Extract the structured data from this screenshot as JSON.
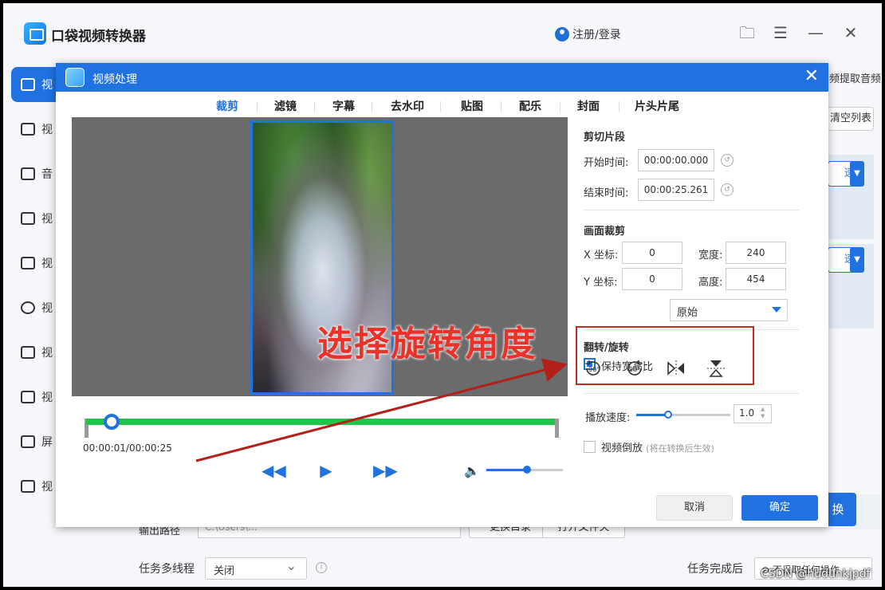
{
  "app": {
    "title": "口袋视频转换器",
    "login": "注册/登录"
  },
  "sidebar": {
    "items": [
      {
        "label": "视",
        "active": true
      },
      {
        "label": "视"
      },
      {
        "label": "音"
      },
      {
        "label": "视"
      },
      {
        "label": "视"
      },
      {
        "label": "视"
      },
      {
        "label": "视"
      },
      {
        "label": "视"
      },
      {
        "label": "屏"
      },
      {
        "label": "视"
      }
    ]
  },
  "main": {
    "extract_audio": "频提取音频",
    "clear_list": "清空列表",
    "speed_suffix": "速)",
    "start_label": "换",
    "output_label": "输出路径",
    "output_path": "C:\\Users\\...",
    "output_btn1": "更换目录",
    "output_btn2": "打开文件夹",
    "multithread_label": "任务多线程",
    "multithread_value": "关闭",
    "done_label": "任务完成后",
    "done_value": "不采取任何操作"
  },
  "watermark": "CSDN @hudunkjpdf",
  "dialog": {
    "title": "视频处理",
    "tabs": [
      "裁剪",
      "滤镜",
      "字幕",
      "去水印",
      "贴图",
      "配乐",
      "封面",
      "片头片尾"
    ],
    "active_tab": 0,
    "annotation": "选择旋转角度",
    "time_display": "00:00:01/00:00:25",
    "progress": 0.0,
    "volume": 0.5,
    "cut": {
      "title": "剪切片段",
      "start_label": "开始时间:",
      "start": "00:00:00.000",
      "end_label": "结束时间:",
      "end": "00:00:25.261"
    },
    "crop": {
      "title": "画面裁剪",
      "x_label": "X 坐标:",
      "x": "0",
      "y_label": "Y 坐标:",
      "y": "0",
      "w_label": "宽度:",
      "w": "240",
      "h_label": "高度:",
      "h": "454",
      "keep_ratio": "保持宽高比",
      "keep_ratio_checked": true,
      "ratio_value": "原始"
    },
    "rotate": {
      "title": "翻转/旋转",
      "icons": [
        "rotate-right-90-icon",
        "rotate-left-90-icon",
        "flip-horizontal-icon",
        "flip-vertical-icon"
      ]
    },
    "speed": {
      "label": "播放速度:",
      "value": "1.0",
      "level": 0.34
    },
    "reverse": {
      "label": "视频倒放",
      "hint": "(将在转换后生效)"
    },
    "cancel": "取消",
    "ok": "确定"
  },
  "colors": {
    "accent": "#1f72e0",
    "timeline": "#22c54a",
    "annotation": "#e8322a"
  }
}
